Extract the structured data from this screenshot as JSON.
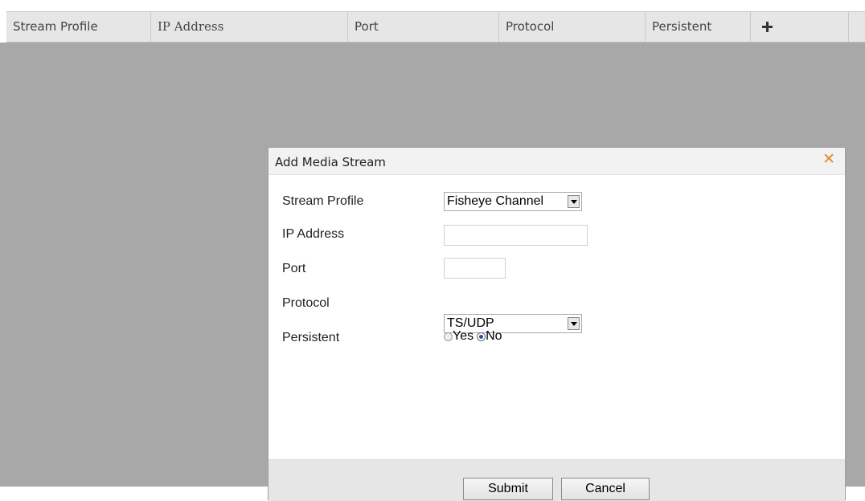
{
  "table": {
    "columns": [
      "Stream Profile",
      "IP Address",
      "Port",
      "Protocol",
      "Persistent"
    ],
    "add_icon": "plus-icon"
  },
  "dialog": {
    "title": "Add Media Stream",
    "close_icon": "close-icon",
    "fields": {
      "stream_profile": {
        "label": "Stream Profile",
        "value": "Fisheye Channel"
      },
      "ip_address": {
        "label": "IP Address",
        "value": ""
      },
      "port": {
        "label": "Port",
        "value": ""
      },
      "protocol": {
        "label": "Protocol",
        "value": "TS/UDP"
      },
      "persistent": {
        "label": "Persistent",
        "options": [
          "Yes",
          "No"
        ],
        "selected": "No"
      }
    },
    "buttons": {
      "submit": "Submit",
      "cancel": "Cancel"
    }
  },
  "colors": {
    "close": "#e08a1e",
    "overlay": "#a8a8a8"
  }
}
